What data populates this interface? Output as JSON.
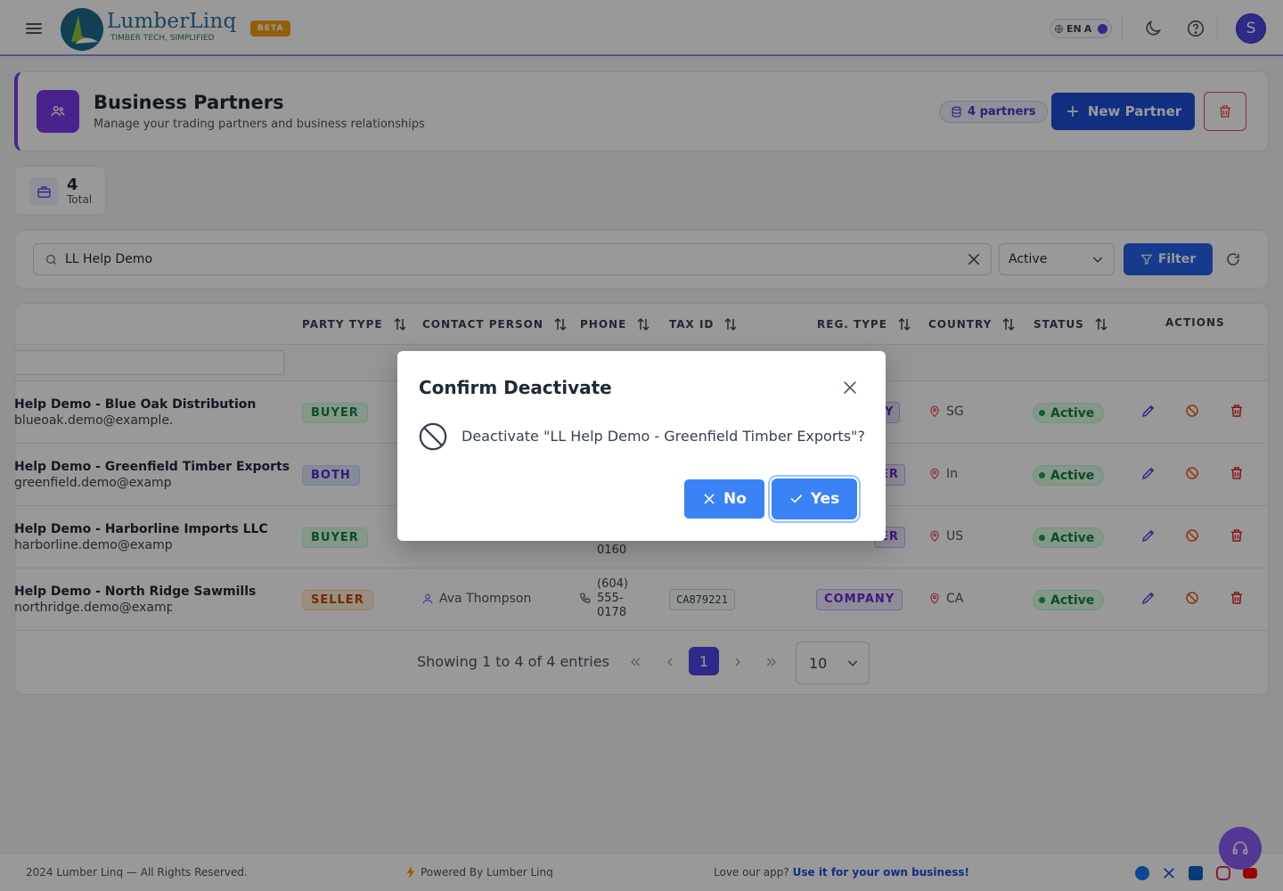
{
  "header": {
    "logo_text": "LumberLinq",
    "logo_tagline": "TIMBER TECH, SIMPLIFIED",
    "beta_label": "BETA",
    "lang_code": "EN",
    "lang_letter": "A",
    "avatar_initial": "S"
  },
  "page": {
    "title": "Business Partners",
    "subtitle": "Manage your trading partners and business relationships",
    "partner_count": "4 partners",
    "new_partner_label": "New Partner",
    "accent_color": "#7c3aed"
  },
  "stats": {
    "total_value": "4",
    "total_label": "Total"
  },
  "filters": {
    "search_value": "LL Help Demo",
    "status_selected": "Active",
    "filter_label": "Filter"
  },
  "table": {
    "columns": [
      "PARTY TYPE",
      "CONTACT PERSON",
      "PHONE",
      "TAX ID",
      "REG. TYPE",
      "COUNTRY",
      "STATUS",
      "ACTIONS"
    ],
    "rows": [
      {
        "name": "Help Demo - Blue Oak Distribution",
        "email": "blueoak.demo@example.c",
        "party_type": "BUYER",
        "reg_type_visible": "Y",
        "country": "SG",
        "status": "Active"
      },
      {
        "name": "Help Demo - Greenfield Timber Exports",
        "email": "greenfield.demo@example",
        "party_type": "BOTH",
        "reg_type_visible": "ER",
        "country": "In",
        "status": "Active"
      },
      {
        "name": "Help Demo - Harborline Imports LLC",
        "email": "harborline.demo@example",
        "party_type": "BUYER",
        "phone_visible": "0160",
        "reg_type_visible": "ER",
        "country": "US",
        "status": "Active"
      },
      {
        "name": "Help Demo - North Ridge Sawmills",
        "email": "northridge.demo@example",
        "party_type": "SELLER",
        "contact": "Ava Thompson",
        "phone_lines": [
          "(604)",
          "555-",
          "0178"
        ],
        "tax_id": "CA879221",
        "reg_type": "COMPANY",
        "country": "CA",
        "status": "Active"
      }
    ]
  },
  "pagination": {
    "info": "Showing 1 to 4 of 4 entries",
    "current_page": "1",
    "page_size": "10"
  },
  "footer": {
    "copyright": "2024 Lumber Linq — All Rights Reserved.",
    "powered": "Powered By Lumber Linq",
    "love_text": "Love our app?",
    "love_link": "Use it for your own business!"
  },
  "modal": {
    "title": "Confirm Deactivate",
    "message": "Deactivate \"LL Help Demo - Greenfield Timber Exports\"?",
    "no_label": "No",
    "yes_label": "Yes"
  }
}
